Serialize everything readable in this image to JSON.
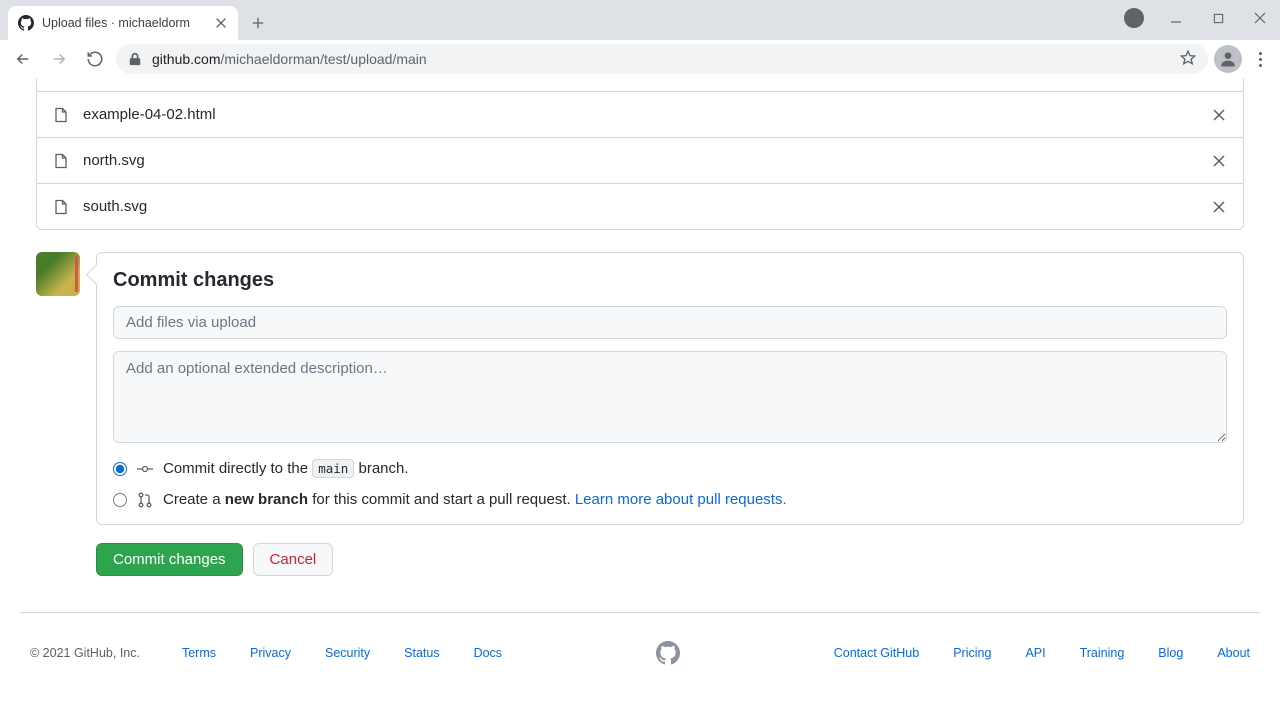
{
  "browser": {
    "tab_title": "Upload files · michaeldorm",
    "url_host": "github.com",
    "url_path": "/michaeldorman/test/upload/main"
  },
  "files": [
    {
      "name": "example-04-02.html"
    },
    {
      "name": "north.svg"
    },
    {
      "name": "south.svg"
    }
  ],
  "commit": {
    "heading": "Commit changes",
    "summary_placeholder": "Add files via upload",
    "description_placeholder": "Add an optional extended description…",
    "radio_direct_prefix": "Commit directly to the ",
    "radio_direct_branch": "main",
    "radio_direct_suffix": " branch.",
    "radio_newbranch_prefix": "Create a ",
    "radio_newbranch_bold": "new branch",
    "radio_newbranch_suffix": " for this commit and start a pull request. ",
    "radio_newbranch_link": "Learn more about pull requests.",
    "commit_button": "Commit changes",
    "cancel_button": "Cancel"
  },
  "footer": {
    "copyright": "© 2021 GitHub, Inc.",
    "links_left": [
      "Terms",
      "Privacy",
      "Security",
      "Status",
      "Docs"
    ],
    "links_right": [
      "Contact GitHub",
      "Pricing",
      "API",
      "Training",
      "Blog",
      "About"
    ]
  }
}
